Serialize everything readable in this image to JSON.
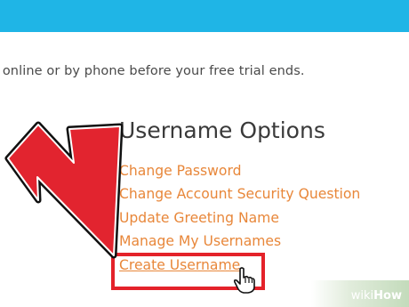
{
  "notice": {
    "text": "l online or by phone before your free trial ends."
  },
  "options": {
    "title": "Username Options",
    "links": [
      "Change Password",
      "Change Account Security Question",
      "Update Greeting Name",
      "Manage My Usernames",
      "Create Username"
    ]
  },
  "colors": {
    "banner": "#1fb5e6",
    "link": "#e8873a",
    "highlight": "#e4222a"
  },
  "icons": {
    "pointer": "hand-pointer-icon",
    "arrow": "red-arrow-annotation"
  },
  "watermark": {
    "brand": "wiki",
    "suffix": "How"
  }
}
